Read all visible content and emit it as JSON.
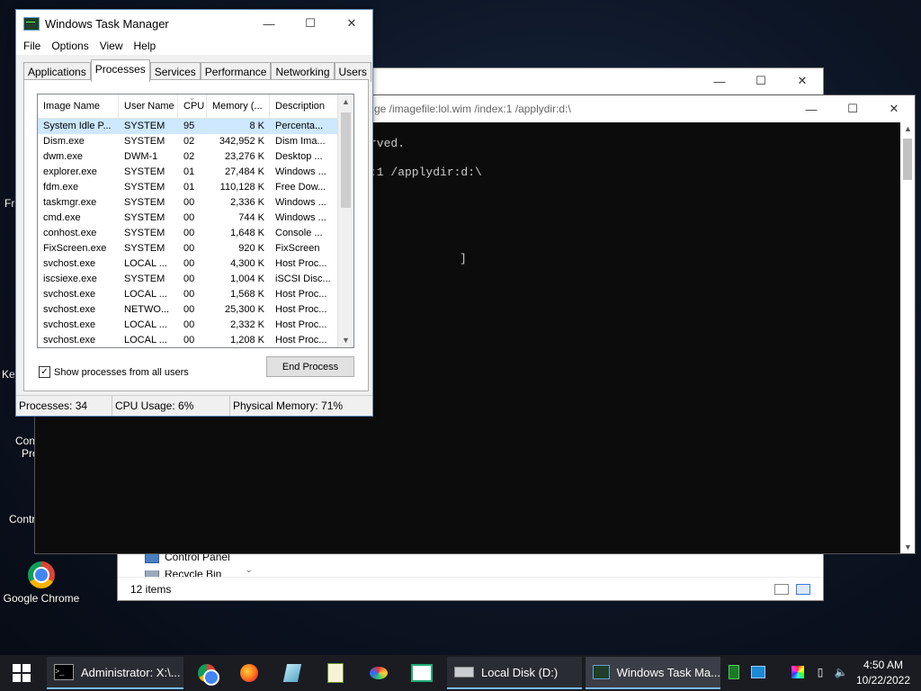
{
  "desktop": {
    "chrome_label": "Google Chrome",
    "frag_fr": "Fr",
    "frag_key": "Key",
    "frag_conti": "Conti",
    "frag_pro": "Pro",
    "frag_contr": "Contr"
  },
  "explorer": {
    "nav_items": [
      "Control Panel",
      "Recycle Bin"
    ],
    "status_items": "12 items"
  },
  "console": {
    "title": "ge /imagefile:lol.wim /index:1 /applydir:d:\\",
    "line1": "rved.",
    "line2": ":1 /applydir:d:\\",
    "line3": "]"
  },
  "taskmanager": {
    "title": "Windows Task Manager",
    "menu": [
      "File",
      "Options",
      "View",
      "Help"
    ],
    "tabs": [
      "Applications",
      "Processes",
      "Services",
      "Performance",
      "Networking",
      "Users"
    ],
    "active_tab": "Processes",
    "columns": [
      "Image Name",
      "User Name",
      "CPU",
      "Memory (...",
      "Description"
    ],
    "rows": [
      [
        "System Idle P...",
        "SYSTEM",
        "95",
        "8 K",
        "Percenta..."
      ],
      [
        "Dism.exe",
        "SYSTEM",
        "02",
        "342,952 K",
        "Dism Ima..."
      ],
      [
        "dwm.exe",
        "DWM-1",
        "02",
        "23,276 K",
        "Desktop ..."
      ],
      [
        "explorer.exe",
        "SYSTEM",
        "01",
        "27,484 K",
        "Windows ..."
      ],
      [
        "fdm.exe",
        "SYSTEM",
        "01",
        "110,128 K",
        "Free Dow..."
      ],
      [
        "taskmgr.exe",
        "SYSTEM",
        "00",
        "2,336 K",
        "Windows ..."
      ],
      [
        "cmd.exe",
        "SYSTEM",
        "00",
        "744 K",
        "Windows ..."
      ],
      [
        "conhost.exe",
        "SYSTEM",
        "00",
        "1,648 K",
        "Console ..."
      ],
      [
        "FixScreen.exe",
        "SYSTEM",
        "00",
        "920 K",
        "FixScreen"
      ],
      [
        "svchost.exe",
        "LOCAL ...",
        "00",
        "4,300 K",
        "Host Proc..."
      ],
      [
        "iscsiexe.exe",
        "SYSTEM",
        "00",
        "1,004 K",
        "iSCSI Disc..."
      ],
      [
        "svchost.exe",
        "LOCAL ...",
        "00",
        "1,568 K",
        "Host Proc..."
      ],
      [
        "svchost.exe",
        "NETWO...",
        "00",
        "25,300 K",
        "Host Proc..."
      ],
      [
        "svchost.exe",
        "LOCAL ...",
        "00",
        "2,332 K",
        "Host Proc..."
      ],
      [
        "svchost.exe",
        "LOCAL ...",
        "00",
        "1,208 K",
        "Host Proc..."
      ]
    ],
    "show_all_label": "Show processes from all users",
    "show_all_checked": true,
    "end_process_label": "End Process",
    "status": {
      "processes": "Processes: 34",
      "cpu": "CPU Usage: 6%",
      "memory": "Physical Memory: 71%"
    }
  },
  "taskbar": {
    "cmd_label": "Administrator: X:\\...",
    "explorer_label": "Local Disk (D:)",
    "taskmgr_label": "Windows Task Ma...",
    "time": "4:50 AM",
    "date": "10/22/2022"
  },
  "colors": {
    "selection": "#cde8ff",
    "console_bg": "#0c0c0c",
    "taskbar_bg": "#1a1c22",
    "accent": "#76b9ed"
  }
}
